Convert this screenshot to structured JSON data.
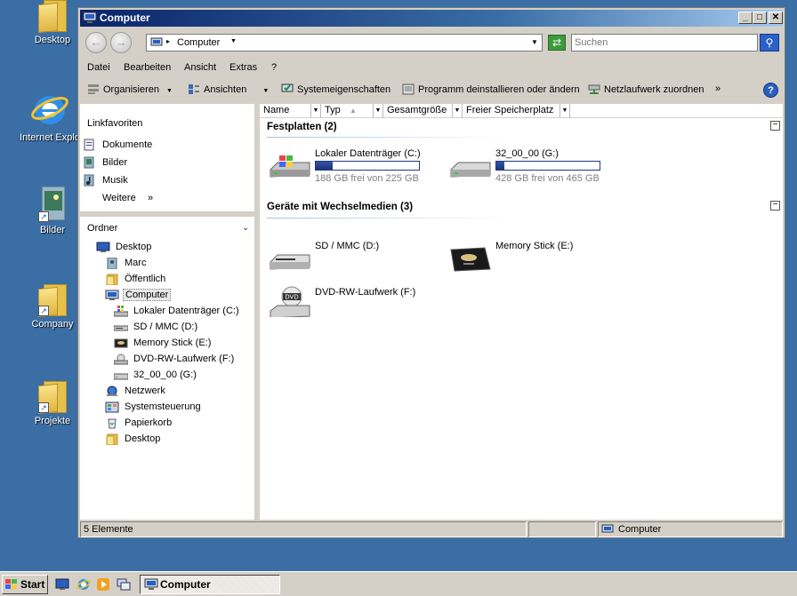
{
  "desktop": {
    "icons": [
      {
        "label": "Desktop",
        "icon": "folder-icon"
      },
      {
        "label": "Internet Explo",
        "icon": "internet-explorer-icon"
      },
      {
        "label": "Bilder",
        "icon": "pictures-shortcut-icon"
      },
      {
        "label": "Company",
        "icon": "folder-shortcut-icon"
      },
      {
        "label": "Projekte",
        "icon": "folder-shortcut-icon"
      }
    ]
  },
  "window": {
    "title": "Computer",
    "controls": {
      "minimize": "_",
      "maximize": "□",
      "close": "✕"
    },
    "address": {
      "location": "Computer",
      "search_placeholder": "Suchen"
    },
    "menu": [
      "Datei",
      "Bearbeiten",
      "Ansicht",
      "Extras",
      "?"
    ],
    "toolbar": {
      "organize": "Organisieren",
      "views": "Ansichten",
      "system_properties": "Systemeigenschaften",
      "uninstall": "Programm deinstallieren oder ändern",
      "map_drive": "Netzlaufwerk zuordnen",
      "more": "»"
    },
    "favorites": {
      "heading": "Linkfavoriten",
      "items": [
        "Dokumente",
        "Bilder",
        "Musik"
      ],
      "more": "Weitere",
      "more_arrows": "»"
    },
    "folders": {
      "heading": "Ordner",
      "tree": [
        {
          "label": "Desktop",
          "icon": "desktop-icon"
        },
        {
          "label": "Marc",
          "icon": "user-folder-icon"
        },
        {
          "label": "Öffentlich",
          "icon": "folder-icon"
        },
        {
          "label": "Computer",
          "icon": "computer-icon"
        },
        {
          "label": "Lokaler Datenträger (C:)",
          "icon": "windows-drive-icon"
        },
        {
          "label": "SD / MMC (D:)",
          "icon": "card-reader-icon"
        },
        {
          "label": "Memory Stick (E:)",
          "icon": "memory-stick-icon"
        },
        {
          "label": "DVD-RW-Laufwerk (F:)",
          "icon": "dvd-drive-icon"
        },
        {
          "label": "32_00_00 (G:)",
          "icon": "hard-drive-icon"
        },
        {
          "label": "Netzwerk",
          "icon": "network-icon"
        },
        {
          "label": "Systemsteuerung",
          "icon": "control-panel-icon"
        },
        {
          "label": "Papierkorb",
          "icon": "recycle-bin-icon"
        },
        {
          "label": "Desktop",
          "icon": "folder-icon"
        }
      ]
    },
    "columns": [
      "Name",
      "Typ",
      "Gesamtgröße",
      "Freier Speicherplatz"
    ],
    "groups": {
      "hard_disks": {
        "title": "Festplatten (2)",
        "drives": [
          {
            "name": "Lokaler Datenträger (C:)",
            "free_text": "188 GB frei von 225 GB",
            "used_fraction": 0.16
          },
          {
            "name": "32_00_00 (G:)",
            "free_text": "428 GB frei von 465 GB",
            "used_fraction": 0.08
          }
        ]
      },
      "removable": {
        "title": "Geräte mit Wechselmedien (3)",
        "drives": [
          {
            "name": "SD / MMC (D:)"
          },
          {
            "name": "Memory Stick (E:)"
          },
          {
            "name": "DVD-RW-Laufwerk (F:)"
          }
        ]
      },
      "collapse_symbol": "−"
    },
    "status": {
      "count": "5 Elemente",
      "location": "Computer"
    }
  },
  "taskbar": {
    "start": "Start",
    "task": "Computer"
  },
  "colors": {
    "desktop": "#3a6ea5",
    "title_start": "#0a246a",
    "bar_fill": "#1c3278"
  }
}
